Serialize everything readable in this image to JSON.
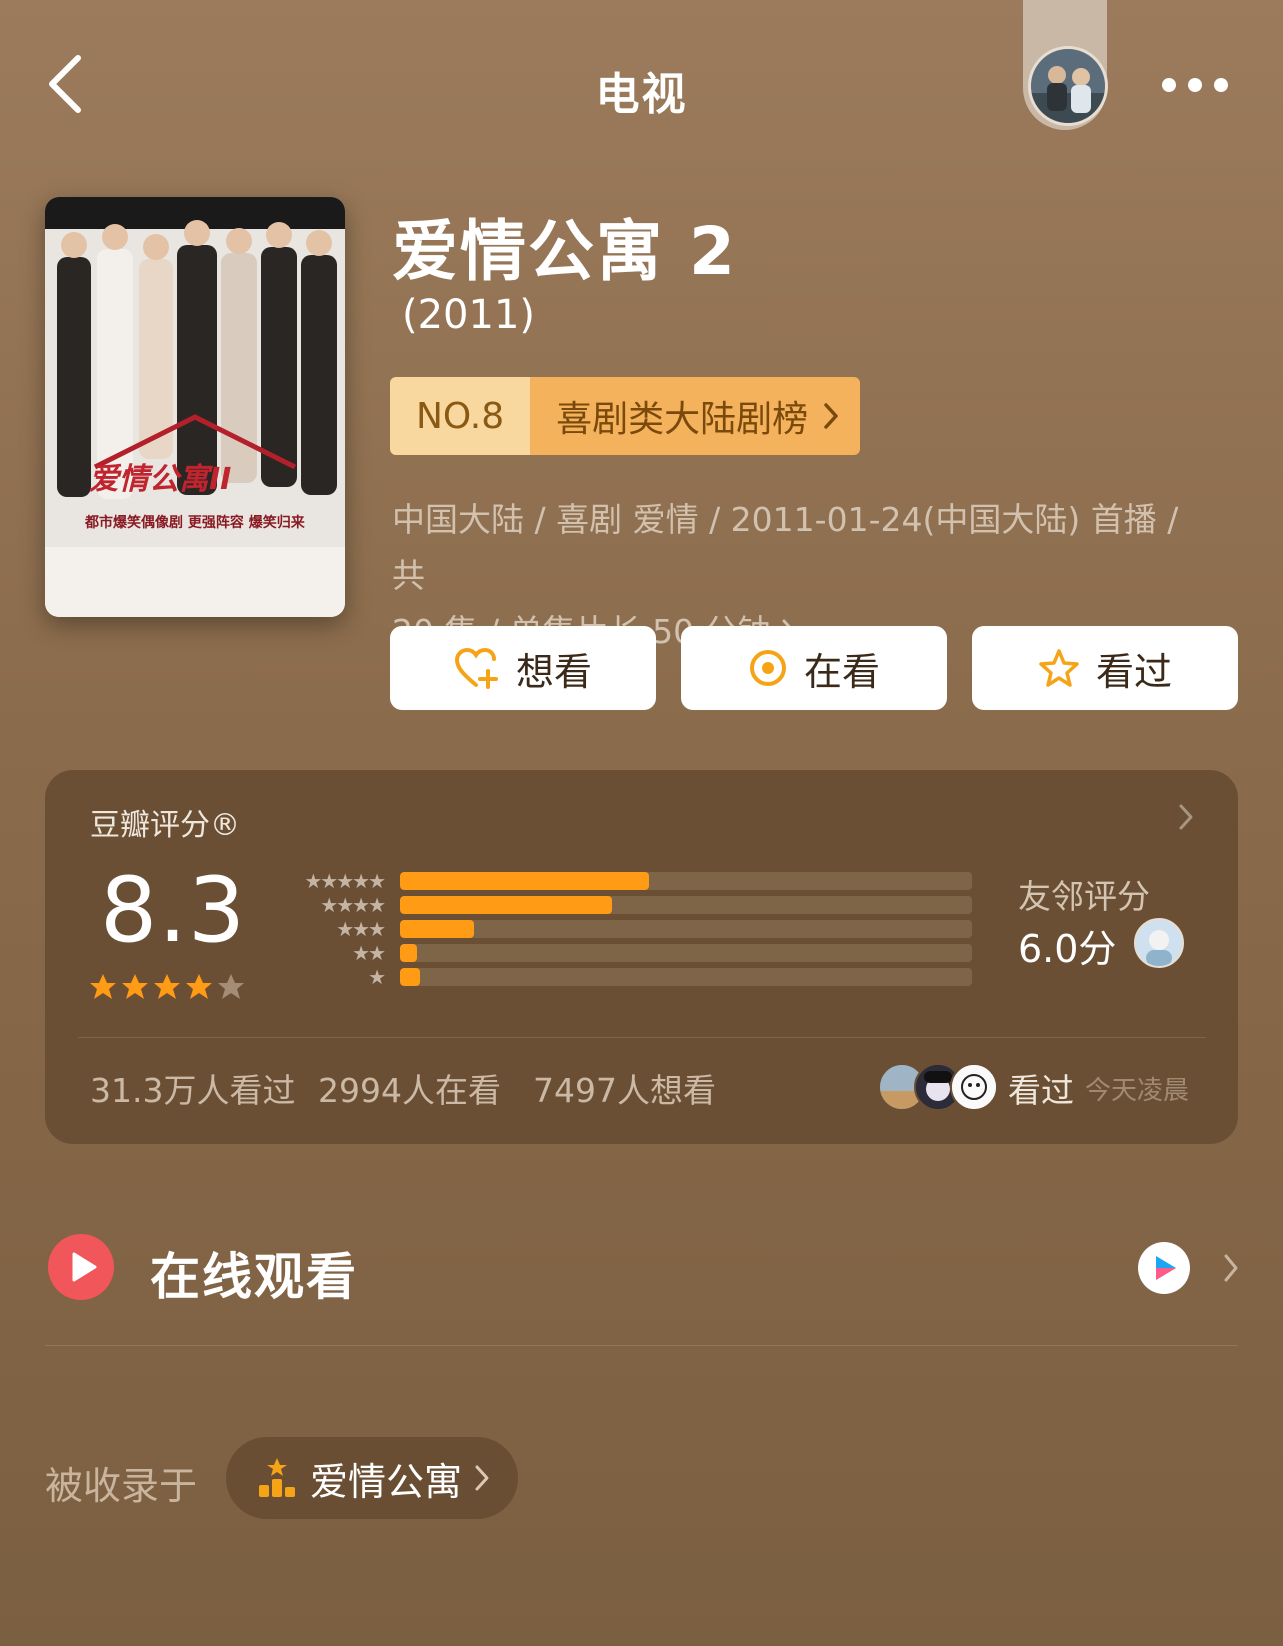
{
  "header": {
    "title": "电视",
    "back_icon": "chevron-left-icon",
    "more_icon": "more-horizontal-icon"
  },
  "show": {
    "title": "爱情公寓 2",
    "year": "(2011)",
    "poster_title": "爱情公寓II",
    "poster_subtitle": "都市爆笑偶像剧  更强阵容 爆笑归来",
    "rank": {
      "number": "NO.8",
      "list_name": "喜剧类大陆剧榜"
    },
    "meta_line1": "中国大陆 / 喜剧 爱情 / 2011-01-24(中国大陆) 首播 / 共",
    "meta_line2": "20 集 / 单集片长 50 分钟"
  },
  "actions": {
    "want": "想看",
    "watching": "在看",
    "watched": "看过"
  },
  "rating": {
    "label": "豆瓣评分®",
    "score": "8.3",
    "stars": 4,
    "distribution_percent": [
      43.5,
      37,
      13,
      3,
      3.5
    ],
    "friend_label": "友邻评分",
    "friend_score": "6.0分"
  },
  "stats": {
    "watched": "31.3万人看过",
    "watching": "2994人在看",
    "want": "7497人想看",
    "friends_status": "看过",
    "friends_time": "今天凌晨"
  },
  "online": {
    "label": "在线观看"
  },
  "collection": {
    "label": "被收录于",
    "name": "爱情公寓"
  },
  "colors": {
    "background": "#8a6b4b",
    "card": "#6a4f35",
    "accent_orange": "#ff9b14",
    "play_red": "#f0565a",
    "rank_light": "#f8d89e",
    "rank_dark": "#f4b25c"
  }
}
